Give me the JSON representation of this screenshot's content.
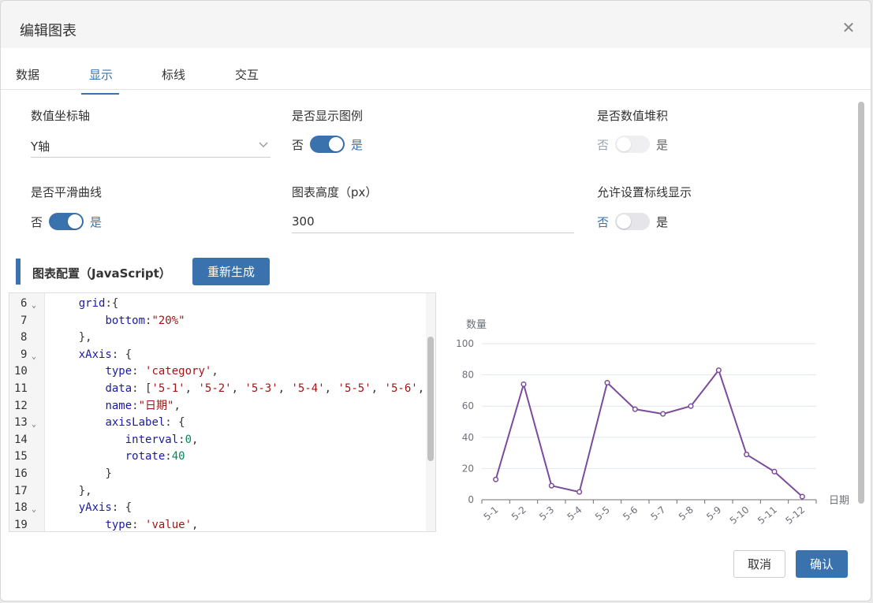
{
  "dialog": {
    "title": "编辑图表"
  },
  "tabs": [
    {
      "label": "数据",
      "active": false
    },
    {
      "label": "显示",
      "active": true
    },
    {
      "label": "标线",
      "active": false
    },
    {
      "label": "交互",
      "active": false
    }
  ],
  "settings": {
    "value_axis": {
      "label": "数值坐标轴",
      "value": "Y轴"
    },
    "show_legend": {
      "label": "是否显示图例",
      "off": "否",
      "on": "是",
      "enabled": true
    },
    "stack_values": {
      "label": "是否数值堆积",
      "off": "否",
      "on": "是",
      "enabled": false
    },
    "smooth_curve": {
      "label": "是否平滑曲线",
      "off": "否",
      "on": "是",
      "enabled": true
    },
    "chart_height": {
      "label": "图表高度（px）",
      "value": "300"
    },
    "allow_markline": {
      "label": "允许设置标线显示",
      "off": "否",
      "on": "是",
      "enabled": false
    }
  },
  "config_section": {
    "title": "图表配置（JavaScript）",
    "regen_label": "重新生成"
  },
  "code_lines": [
    {
      "no": "6",
      "fold": true
    },
    {
      "no": "7",
      "fold": false
    },
    {
      "no": "8",
      "fold": false
    },
    {
      "no": "9",
      "fold": true
    },
    {
      "no": "10",
      "fold": false
    },
    {
      "no": "11",
      "fold": false
    },
    {
      "no": "12",
      "fold": false
    },
    {
      "no": "13",
      "fold": true
    },
    {
      "no": "14",
      "fold": false
    },
    {
      "no": "15",
      "fold": false
    },
    {
      "no": "16",
      "fold": false
    },
    {
      "no": "17",
      "fold": false
    },
    {
      "no": "18",
      "fold": true
    },
    {
      "no": "19",
      "fold": false
    }
  ],
  "code_text": {
    "l6a": "grid",
    "l6b": ":{",
    "l7a": "bottom",
    "l7b": ":",
    "l7c": "\"20%\"",
    "l8": "},",
    "l9a": "xAxis",
    "l9b": ": {",
    "l10a": "type",
    "l10b": ": ",
    "l10c": "'category'",
    "l10d": ",",
    "l11a": "data",
    "l11b": ": [",
    "l11c1": "'5-1'",
    "l11c2": "'5-2'",
    "l11c3": "'5-3'",
    "l11c4": "'5-4'",
    "l11c5": "'5-5'",
    "l11c6": "'5-6'",
    "l11sep": ", ",
    "l11end": ",",
    "l12a": "name",
    "l12b": ":",
    "l12c": "\"日期\"",
    "l12d": ",",
    "l13a": "axisLabel",
    "l13b": ": {",
    "l14a": "interval",
    "l14b": ":",
    "l14c": "0",
    "l14d": ",",
    "l15a": "rotate",
    "l15b": ":",
    "l15c": "40",
    "l16": "}",
    "l17": "},",
    "l18a": "yAxis",
    "l18b": ": {",
    "l19a": "type",
    "l19b": ": ",
    "l19c": "'value'",
    "l19d": ","
  },
  "chart_data": {
    "type": "line",
    "categories": [
      "5-1",
      "5-2",
      "5-3",
      "5-4",
      "5-5",
      "5-6",
      "5-7",
      "5-8",
      "5-9",
      "5-10",
      "5-11",
      "5-12"
    ],
    "values": [
      13,
      74,
      9,
      5,
      75,
      58,
      55,
      60,
      83,
      29,
      18,
      2
    ],
    "xlabel": "日期",
    "ylabel": "数量",
    "ylim": [
      0,
      100
    ],
    "yticks": [
      0,
      20,
      40,
      60,
      80,
      100
    ],
    "color": "#7a4c9a",
    "grid": true
  },
  "footer": {
    "cancel_label": "取消",
    "confirm_label": "确认"
  },
  "colors": {
    "accent": "#3a72ad",
    "series": "#7a4c9a"
  }
}
